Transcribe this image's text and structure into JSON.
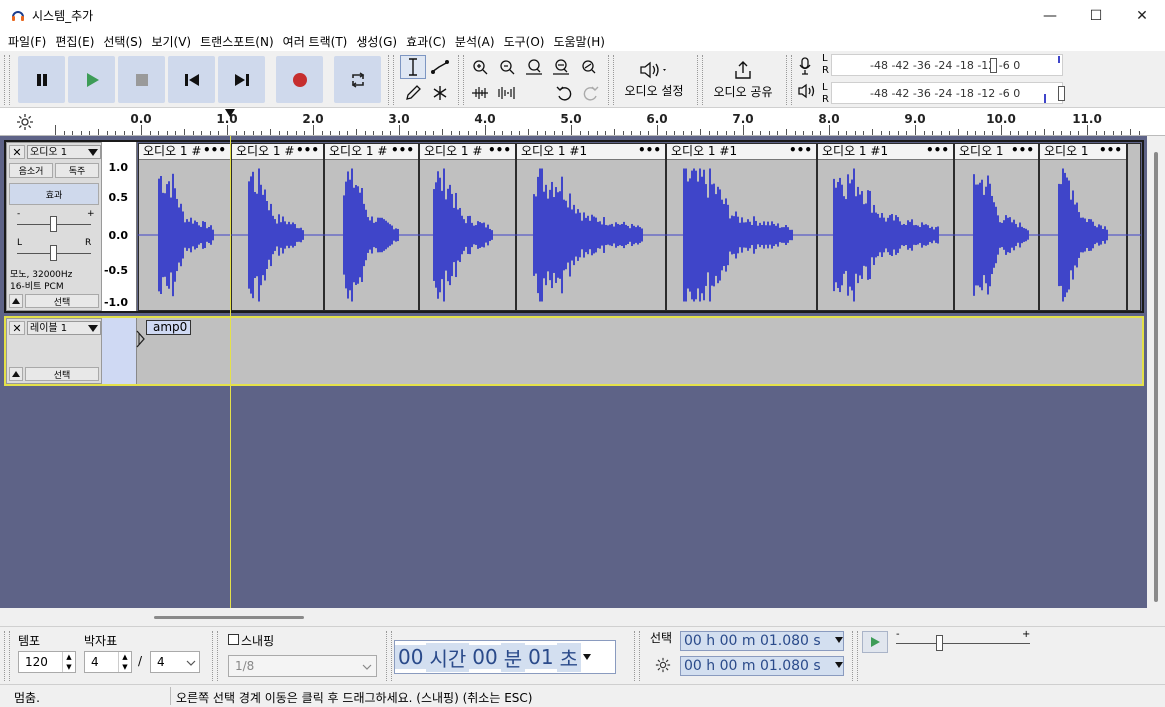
{
  "window": {
    "title": "시스템_추가",
    "minimize": "—",
    "maximize": "☐",
    "close": "✕"
  },
  "menu": [
    "파일(F)",
    "편집(E)",
    "선택(S)",
    "보기(V)",
    "트랜스포트(N)",
    "여러 트랙(T)",
    "생성(G)",
    "효과(C)",
    "분석(A)",
    "도구(O)",
    "도움말(H)"
  ],
  "toolbar": {
    "audio_setup_label": "오디오 설정",
    "share_audio_label": "오디오 공유",
    "record_meter_scale": "-48 -42 -36    -24 -18 -12 -6   0",
    "play_meter_scale": "-48 -42 -36    -24 -18 -12 -6   0",
    "meter_l": "L",
    "meter_r": "R"
  },
  "ruler": {
    "labels": [
      "0.0",
      "1.0",
      "2.0",
      "3.0",
      "4.0",
      "5.0",
      "6.0",
      "7.0",
      "8.0",
      "9.0",
      "10.0",
      "11.0"
    ]
  },
  "audio_track": {
    "name": "오디오 1",
    "mute": "음소거",
    "solo": "독주",
    "effects": "효과",
    "gain_minus": "-",
    "gain_plus": "+",
    "pan_l": "L",
    "pan_r": "R",
    "info_line1": "모노, 32000Hz",
    "info_line2": "16-비트 PCM",
    "select": "선택",
    "scale": [
      "1.0",
      "0.5",
      "0.0",
      "-0.5",
      "-1.0"
    ],
    "clips": [
      "오디오 1 #",
      "오디오 1 #",
      "오디오 1 #",
      "오디오 1 #",
      "오디오 1 #1",
      "오디오 1 #1",
      "오디오 1 #1",
      "오디오 1",
      "오디오 1"
    ],
    "clip_menu": "•••"
  },
  "label_track": {
    "name": "레이블 1",
    "select": "선택",
    "label": "amp0"
  },
  "bottom": {
    "tempo_label": "템포",
    "tempo_value": "120",
    "timesig_label": "박자표",
    "timesig_num": "4",
    "timesig_sep": "/",
    "timesig_den": "4",
    "snap_label": "스내핑",
    "snap_value": "1/8",
    "time_hours": "00",
    "time_h_unit": "시간",
    "time_minutes": "00",
    "time_m_unit": "분",
    "time_seconds": "01",
    "time_s_unit": "초",
    "selection_label": "선택",
    "sel_start": "00 h 00 m 01.080 s",
    "sel_end": "00 h 00 m 01.080 s",
    "speed_minus": "-",
    "speed_plus": "+"
  },
  "status": {
    "state": "멈춤.",
    "message": "오른쪽 선택 경계 이동은 클릭 후 드래그하세요. (스내핑) (취소는 ESC)"
  },
  "colors": {
    "waveform": "#3f45c9",
    "clip_bg": "#c0c0c0",
    "track_bg": "#5e6387",
    "play_green": "#3d9c57",
    "record_red": "#c62e2e",
    "cursor": "#e4e14a"
  }
}
